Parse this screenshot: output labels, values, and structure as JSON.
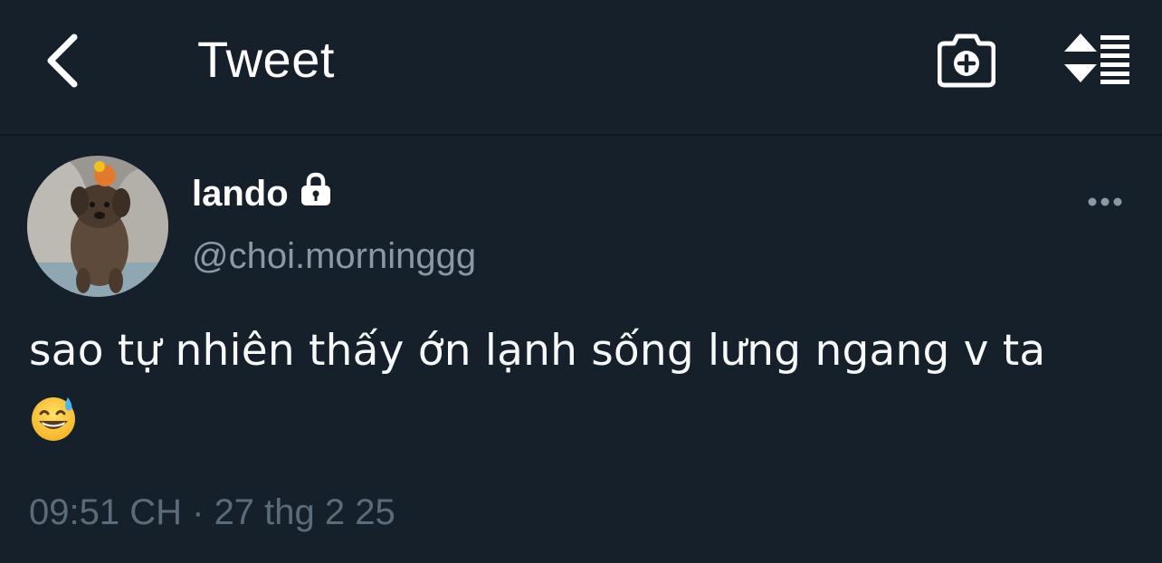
{
  "header": {
    "title": "Tweet",
    "back_icon": "chevron-left-icon",
    "camera_icon": "camera-add-icon",
    "sort_icon": "sort-list-icon"
  },
  "tweet": {
    "display_name": "lando",
    "handle": "@choi.morninggg",
    "protected": true,
    "text": "sao tự nhiên thấy ớn lạnh sống lưng ngang v ta",
    "emoji": "grinning-face-with-sweat",
    "time": "09:51 CH",
    "separator": "·",
    "date": "27 thg 2 25"
  },
  "colors": {
    "background": "#15202b",
    "text": "#ffffff",
    "secondary": "#8b98a5",
    "meta": "#5c6b79"
  }
}
